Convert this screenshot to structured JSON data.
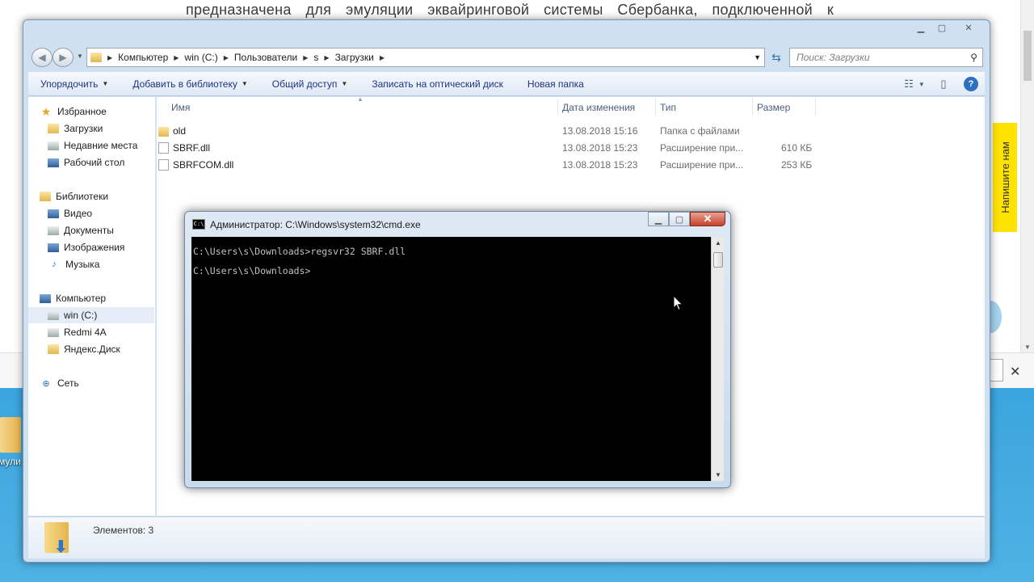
{
  "background_page": {
    "text": "предназначена для эмуляции эквайринговой системы Сбербанка, подключенной к",
    "feedback_tab": "Напишите нам"
  },
  "desktop": {
    "icon_label": "мули"
  },
  "explorer": {
    "breadcrumbs": [
      "Компьютер",
      "win (C:)",
      "Пользователи",
      "s",
      "Загрузки"
    ],
    "search_placeholder": "Поиск: Загрузки",
    "toolbar": {
      "organize": "Упорядочить",
      "add_to_library": "Добавить в библиотеку",
      "share": "Общий доступ",
      "burn": "Записать на оптический диск",
      "new_folder": "Новая папка"
    },
    "nav": {
      "favorites": "Избранное",
      "downloads": "Загрузки",
      "recent": "Недавние места",
      "desktop": "Рабочий стол",
      "libraries": "Библиотеки",
      "video": "Видео",
      "documents": "Документы",
      "images": "Изображения",
      "music": "Музыка",
      "computer": "Компьютер",
      "drive_c": "win (C:)",
      "redmi": "Redmi 4A",
      "yandex": "Яндекс.Диск",
      "network": "Сеть"
    },
    "columns": {
      "name": "Имя",
      "date": "Дата изменения",
      "type": "Тип",
      "size": "Размер"
    },
    "files": [
      {
        "name": "old",
        "date": "13.08.2018 15:16",
        "type": "Папка с файлами",
        "size": "",
        "icon": "folder-icon"
      },
      {
        "name": "SBRF.dll",
        "date": "13.08.2018 15:23",
        "type": "Расширение при...",
        "size": "610 КБ",
        "icon": "dll-file-icon"
      },
      {
        "name": "SBRFCOM.dll",
        "date": "13.08.2018 15:23",
        "type": "Расширение при...",
        "size": "253 КБ",
        "icon": "dll-file-icon"
      }
    ],
    "status": "Элементов: 3"
  },
  "cmd": {
    "title": "Администратор: C:\\Windows\\system32\\cmd.exe",
    "lines": [
      "C:\\Users\\s\\Downloads>regsvr32 SBRF.dll",
      "C:\\Users\\s\\Downloads>"
    ]
  },
  "colors": {
    "toolbar_text": "#1e3287",
    "cmd_bg": "#000000",
    "cmd_text": "#c0c0c0",
    "feedback_tab": "#ffe300"
  }
}
